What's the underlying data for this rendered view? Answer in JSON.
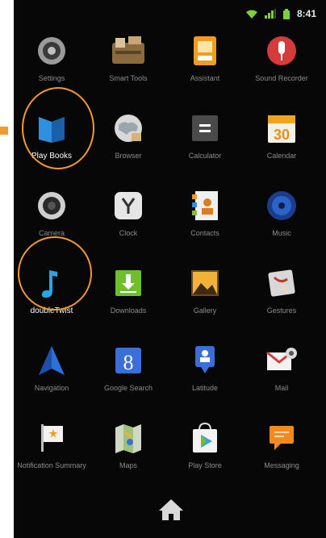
{
  "status": {
    "time": "8:41",
    "icons": [
      "wifi-icon",
      "signal-icon",
      "battery-icon"
    ],
    "accent": "#7fd13b"
  },
  "apps": [
    {
      "label": "Settings",
      "icon": "settings-icon"
    },
    {
      "label": "Smart Tools",
      "icon": "smart-tools-icon"
    },
    {
      "label": "Assistant",
      "icon": "assistant-icon"
    },
    {
      "label": "Sound Recorder",
      "icon": "sound-recorder-icon"
    },
    {
      "label": "Play Books",
      "icon": "play-books-icon",
      "highlighted": true
    },
    {
      "label": "Browser",
      "icon": "browser-icon"
    },
    {
      "label": "Calculator",
      "icon": "calculator-icon"
    },
    {
      "label": "Calendar",
      "icon": "calendar-icon",
      "icon_text": "30"
    },
    {
      "label": "Camera",
      "icon": "camera-icon"
    },
    {
      "label": "Clock",
      "icon": "clock-icon"
    },
    {
      "label": "Contacts",
      "icon": "contacts-icon"
    },
    {
      "label": "Music",
      "icon": "music-icon"
    },
    {
      "label": "doubleTwist",
      "icon": "doubletwist-icon",
      "highlighted": true
    },
    {
      "label": "Downloads",
      "icon": "downloads-icon"
    },
    {
      "label": "Gallery",
      "icon": "gallery-icon"
    },
    {
      "label": "Gestures",
      "icon": "gestures-icon"
    },
    {
      "label": "Navigation",
      "icon": "navigation-icon"
    },
    {
      "label": "Google Search",
      "icon": "google-search-icon",
      "icon_text": "8"
    },
    {
      "label": "Latitude",
      "icon": "latitude-icon"
    },
    {
      "label": "Mail",
      "icon": "mail-icon"
    },
    {
      "label": "Notification Summary",
      "icon": "notification-summary-icon"
    },
    {
      "label": "Maps",
      "icon": "maps-icon"
    },
    {
      "label": "Play Store",
      "icon": "play-store-icon"
    },
    {
      "label": "Messaging",
      "icon": "messaging-icon"
    }
  ],
  "highlight_color": "#f39a2e",
  "home_icon": "home-icon"
}
